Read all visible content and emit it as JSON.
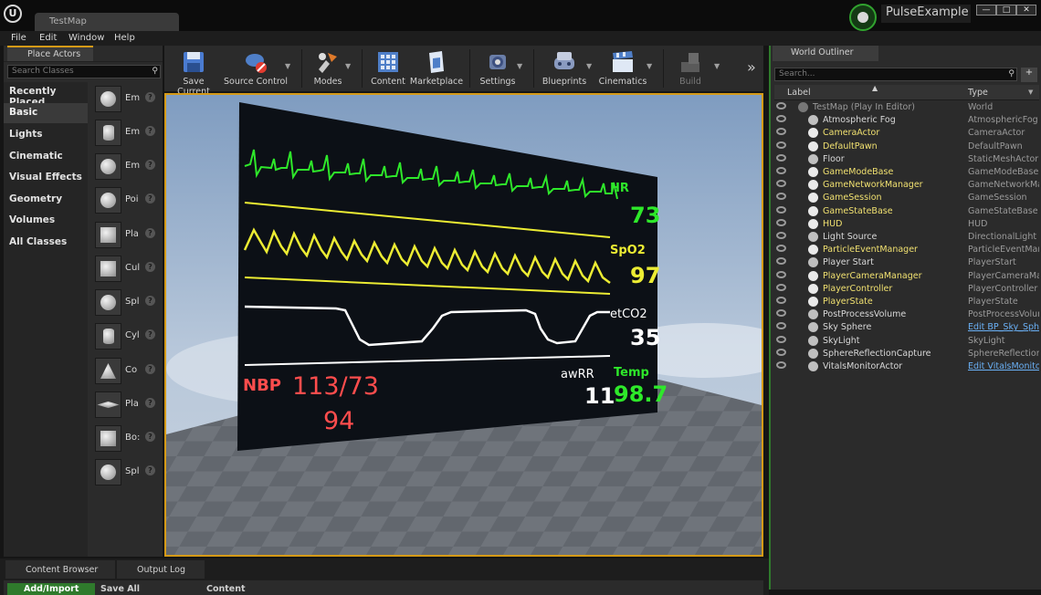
{
  "titlebar": {
    "tab": "TestMap",
    "project": "PulseExample",
    "min": "—",
    "max": "□",
    "close": "✕",
    "logo": "U"
  },
  "menu": [
    "File",
    "Edit",
    "Window",
    "Help"
  ],
  "place_actors": {
    "tab": "Place Actors",
    "search_placeholder": "Search Classes",
    "categories": [
      "Recently Placed",
      "Basic",
      "Lights",
      "Cinematic",
      "Visual Effects",
      "Geometry",
      "Volumes",
      "All Classes"
    ],
    "selected_category": "Basic",
    "items": [
      {
        "label": "Em",
        "icon": "empty-actor-icon"
      },
      {
        "label": "Em",
        "icon": "empty-character-icon"
      },
      {
        "label": "Em",
        "icon": "empty-pawn-icon"
      },
      {
        "label": "Poi",
        "icon": "point-light-icon"
      },
      {
        "label": "Pla",
        "icon": "player-start-icon"
      },
      {
        "label": "Cul",
        "icon": "cube-icon"
      },
      {
        "label": "Spl",
        "icon": "sphere-icon"
      },
      {
        "label": "Cyl",
        "icon": "cylinder-icon"
      },
      {
        "label": "Co",
        "icon": "cone-icon"
      },
      {
        "label": "Pla",
        "icon": "plane-icon"
      },
      {
        "label": "Bo:",
        "icon": "box-trigger-icon"
      },
      {
        "label": "Spl",
        "icon": "sphere-trigger-icon"
      }
    ]
  },
  "toolbar": {
    "buttons": [
      {
        "label": "Save Current",
        "icon": "save-icon"
      },
      {
        "label": "Source Control",
        "icon": "source-control-icon"
      },
      {
        "label": "Modes",
        "icon": "modes-icon"
      },
      {
        "label": "Content",
        "icon": "content-icon"
      },
      {
        "label": "Marketplace",
        "icon": "marketplace-icon"
      },
      {
        "label": "Settings",
        "icon": "settings-icon"
      },
      {
        "label": "Blueprints",
        "icon": "blueprints-icon"
      },
      {
        "label": "Cinematics",
        "icon": "cinematics-icon"
      },
      {
        "label": "Build",
        "icon": "build-icon"
      }
    ],
    "more": "»"
  },
  "monitor": {
    "hr_label": "HR",
    "hr_value": "73",
    "spo2_label": "SpO2",
    "spo2_value": "97",
    "etco2_label": "etCO2",
    "etco2_value": "35",
    "nbp_label": "NBP",
    "nbp_value": "113/73",
    "nbp_mean": "94",
    "awrr_label": "awRR",
    "awrr_value": "11",
    "temp_label": "Temp",
    "temp_value": "98.7",
    "colors": {
      "hr": "#2ee82a",
      "spo2": "#ecec33",
      "etco2": "#ffffff",
      "nbp": "#ff4d4d",
      "temp": "#2ee82a"
    }
  },
  "outliner": {
    "tab": "World Outliner",
    "search_placeholder": "Search...",
    "col_label": "Label",
    "col_type": "Type",
    "sort_arrow": "▲",
    "rows": [
      {
        "label": "TestMap (Play In Editor)",
        "type": "World",
        "color": "#9a9a9a",
        "indent": 0,
        "icon": "world-icon"
      },
      {
        "label": "Atmospheric Fog",
        "type": "AtmosphericFog",
        "color": "#d8d8d8",
        "indent": 1,
        "icon": "fog-icon"
      },
      {
        "label": "CameraActor",
        "type": "CameraActor",
        "color": "#f0e070",
        "indent": 1,
        "icon": "camera-icon"
      },
      {
        "label": "DefaultPawn",
        "type": "DefaultPawn",
        "color": "#f0e070",
        "indent": 1,
        "icon": "pawn-icon"
      },
      {
        "label": "Floor",
        "type": "StaticMeshActor",
        "color": "#d8d8d8",
        "indent": 1,
        "icon": "mesh-icon"
      },
      {
        "label": "GameModeBase",
        "type": "GameModeBase",
        "color": "#f0e070",
        "indent": 1,
        "icon": "actor-icon"
      },
      {
        "label": "GameNetworkManager",
        "type": "GameNetworkMan",
        "color": "#f0e070",
        "indent": 1,
        "icon": "actor-icon"
      },
      {
        "label": "GameSession",
        "type": "GameSession",
        "color": "#f0e070",
        "indent": 1,
        "icon": "actor-icon"
      },
      {
        "label": "GameStateBase",
        "type": "GameStateBase",
        "color": "#f0e070",
        "indent": 1,
        "icon": "actor-icon"
      },
      {
        "label": "HUD",
        "type": "HUD",
        "color": "#f0e070",
        "indent": 1,
        "icon": "hud-icon"
      },
      {
        "label": "Light Source",
        "type": "DirectionalLight",
        "color": "#d8d8d8",
        "indent": 1,
        "icon": "light-icon"
      },
      {
        "label": "ParticleEventManager",
        "type": "ParticleEventMana",
        "color": "#f0e070",
        "indent": 1,
        "icon": "actor-icon"
      },
      {
        "label": "Player Start",
        "type": "PlayerStart",
        "color": "#d8d8d8",
        "indent": 1,
        "icon": "player-start-icon"
      },
      {
        "label": "PlayerCameraManager",
        "type": "PlayerCameraMan",
        "color": "#f0e070",
        "indent": 1,
        "icon": "actor-icon"
      },
      {
        "label": "PlayerController",
        "type": "PlayerController",
        "color": "#f0e070",
        "indent": 1,
        "icon": "actor-icon"
      },
      {
        "label": "PlayerState",
        "type": "PlayerState",
        "color": "#f0e070",
        "indent": 1,
        "icon": "actor-icon"
      },
      {
        "label": "PostProcessVolume",
        "type": "PostProcessVolume",
        "color": "#d8d8d8",
        "indent": 1,
        "icon": "volume-icon"
      },
      {
        "label": "Sky Sphere",
        "type": "Edit BP_Sky_Sph",
        "color": "#d8d8d8",
        "indent": 1,
        "icon": "sky-sphere-icon",
        "link": true
      },
      {
        "label": "SkyLight",
        "type": "SkyLight",
        "color": "#d8d8d8",
        "indent": 1,
        "icon": "skylight-icon"
      },
      {
        "label": "SphereReflectionCapture",
        "type": "SphereReflectionCa",
        "color": "#d8d8d8",
        "indent": 1,
        "icon": "reflection-icon"
      },
      {
        "label": "VitalsMonitorActor",
        "type": "Edit VitalsMonito",
        "color": "#d8d8d8",
        "indent": 1,
        "icon": "actor-icon",
        "link": true
      }
    ]
  },
  "bottom": {
    "tab_content": "Content Browser",
    "tab_output": "Output Log",
    "add_import": "Add/Import",
    "save_all": "Save All",
    "content": "Content"
  }
}
